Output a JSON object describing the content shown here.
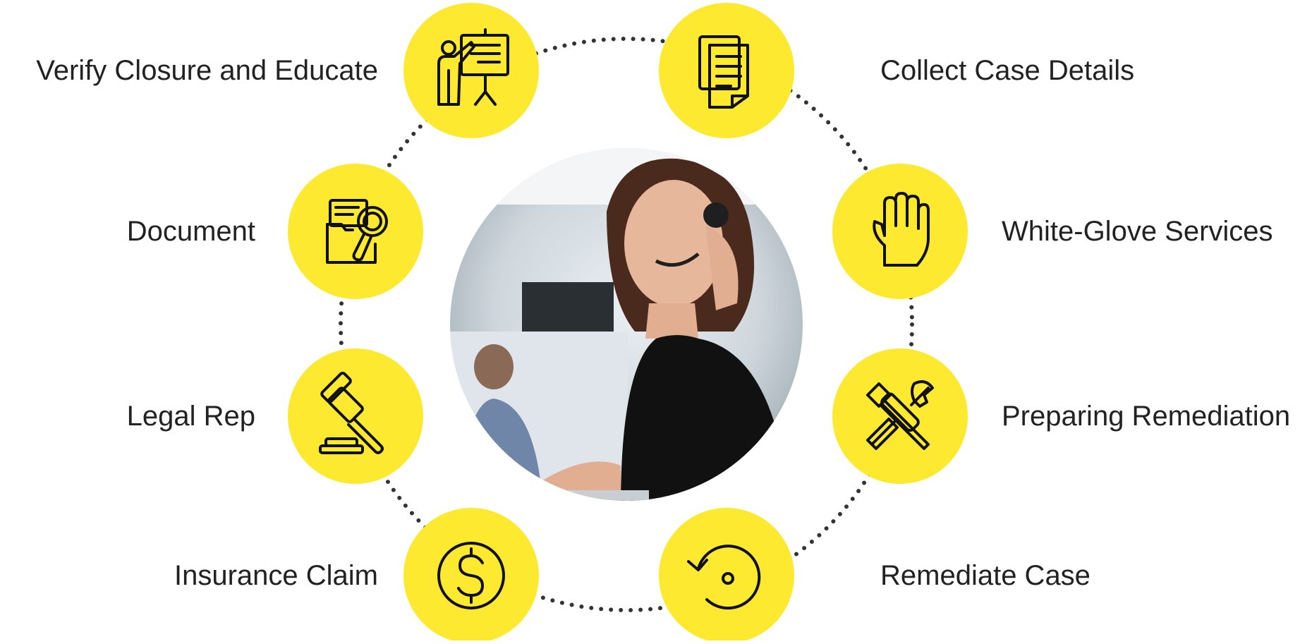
{
  "colors": {
    "accent": "#FDE92F",
    "icon_stroke": "#111111",
    "dots": "#333333",
    "text": "#222222"
  },
  "steps": [
    {
      "label": "Collect Case Details",
      "icon": "documents-icon"
    },
    {
      "label": "White-Glove Services",
      "icon": "hand-icon"
    },
    {
      "label": "Preparing Remediation",
      "icon": "tools-icon"
    },
    {
      "label": "Remediate Case",
      "icon": "refresh-icon"
    },
    {
      "label": "Insurance Claim",
      "icon": "dollar-coin-icon"
    },
    {
      "label": "Legal Rep",
      "icon": "gavel-icon"
    },
    {
      "label": "Document",
      "icon": "folder-search-icon"
    },
    {
      "label": "Verify Closure and Educate",
      "icon": "presenter-icon"
    }
  ],
  "center_image": {
    "subject": "customer-service-agent-photo"
  }
}
